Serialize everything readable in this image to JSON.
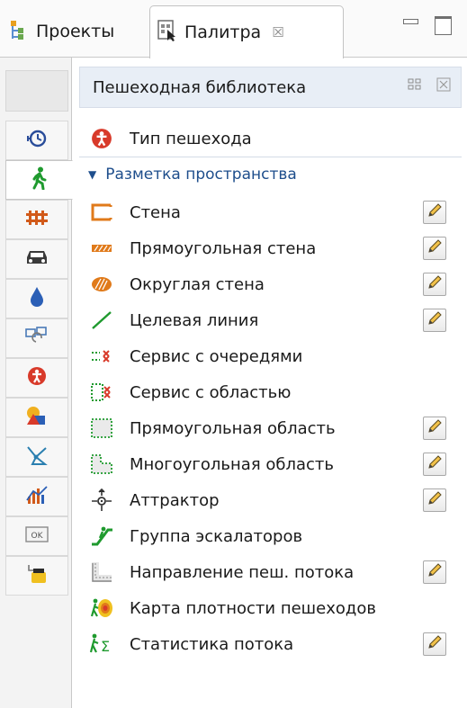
{
  "tabs": {
    "projects_label": "Проекты",
    "palette_label": "Палитра",
    "palette_close": "☒"
  },
  "panel": {
    "title": "Пешеходная библиотека"
  },
  "pedestrian_type": {
    "label": "Тип пешехода"
  },
  "section": {
    "label": "Разметка пространства"
  },
  "items": [
    {
      "label": "Стена",
      "icon": "wall-icon",
      "editable": true
    },
    {
      "label": "Прямоугольная стена",
      "icon": "rectangular-wall-icon",
      "editable": true
    },
    {
      "label": "Округлая стена",
      "icon": "circular-wall-icon",
      "editable": true
    },
    {
      "label": "Целевая линия",
      "icon": "target-line-icon",
      "editable": true
    },
    {
      "label": "Сервис с очередями",
      "icon": "service-queues-icon",
      "editable": false
    },
    {
      "label": "Сервис с областью",
      "icon": "service-area-icon",
      "editable": false
    },
    {
      "label": "Прямоугольная область",
      "icon": "rectangular-area-icon",
      "editable": true
    },
    {
      "label": "Многоугольная область",
      "icon": "polygonal-area-icon",
      "editable": true
    },
    {
      "label": "Аттрактор",
      "icon": "attractor-icon",
      "editable": true
    },
    {
      "label": "Группа эскалаторов",
      "icon": "escalator-group-icon",
      "editable": false
    },
    {
      "label": "Направление пеш. потока",
      "icon": "flow-direction-icon",
      "editable": true
    },
    {
      "label": "Карта плотности пешеходов",
      "icon": "density-map-icon",
      "editable": false
    },
    {
      "label": "Статистика потока",
      "icon": "flow-statistics-icon",
      "editable": true
    }
  ],
  "colors": {
    "accent_orange": "#e07a1a",
    "accent_green": "#1f9a2e",
    "accent_red": "#d83a2a",
    "section_blue": "#1e4e8c"
  }
}
